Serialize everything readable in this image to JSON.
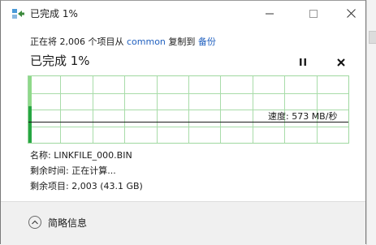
{
  "window": {
    "title": "已完成 1%"
  },
  "copy": {
    "prefix": "正在将 2,006 个项目从 ",
    "source": "common",
    "middle": " 复制到 ",
    "destination": "备份"
  },
  "progress": {
    "header": "已完成 1%",
    "percent": 1,
    "speed_text": "速度: 573 MB/秒"
  },
  "details": {
    "name": "名称: LINKFILE_000.BIN",
    "time_remaining": "剩余时间: 正在计算...",
    "items_remaining": "剩余项目: 2,003 (43.1 GB)"
  },
  "footer": {
    "toggle_label": "简略信息"
  },
  "icons": {
    "title": "copy-arrow-icon",
    "minimize": "minimize-icon",
    "maximize": "maximize-icon",
    "close": "close-icon",
    "pause": "pause-icon",
    "stop": "stop-icon",
    "toggle": "chevron-up-icon"
  },
  "colors": {
    "link": "#1f5fbf",
    "chart_grid": "#a8dca9",
    "chart_fill": "#8fd98a",
    "chart_bar": "#26a642",
    "speed_line": "#1a1a1a",
    "footer_bg": "#f0f0f0"
  }
}
